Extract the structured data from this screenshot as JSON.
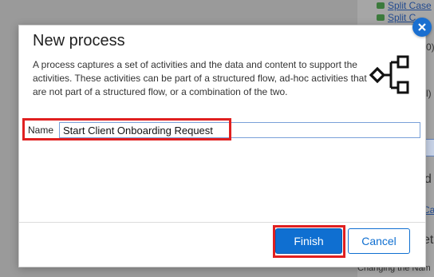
{
  "background": {
    "links": [
      "Split Case",
      "Split C"
    ],
    "fragments": [
      "0)",
      "l)",
      "d",
      "Ca",
      "et",
      "Changing the Nam"
    ]
  },
  "dialog": {
    "title": "New process",
    "description": "A process captures a set of activities and the data and content to support the activities. These activities can be part of a structured flow, ad-hoc activities that are not part of a structured flow, or a combination of the two.",
    "icon": "process-flow-icon",
    "name_label": "Name",
    "name_value": "Start Client Onboarding Request",
    "finish_label": "Finish",
    "cancel_label": "Cancel",
    "close_icon": "close-icon"
  },
  "colors": {
    "primary": "#0f6fd1",
    "highlight": "#e02020"
  }
}
